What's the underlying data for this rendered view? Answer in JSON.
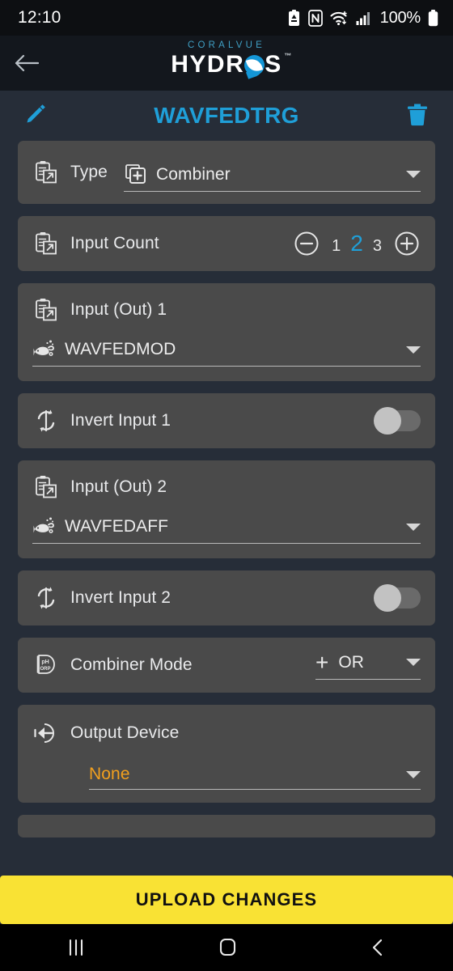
{
  "status_bar": {
    "time": "12:10",
    "battery_percent": "100%",
    "icons": [
      "battery-saver-icon",
      "nfc-icon",
      "wifi-icon",
      "cellular-signal-icon",
      "battery-icon"
    ]
  },
  "app_bar": {
    "back_icon": "arrow-left-icon",
    "brand_top": "CORALVUE",
    "brand_main_before": "HYDR",
    "brand_main_after": "S",
    "trademark": "™"
  },
  "title_bar": {
    "edit_icon": "pencil-icon",
    "title": "WAVFEDTRG",
    "delete_icon": "trash-icon",
    "title_color": "#1f9fd8"
  },
  "rows": {
    "type": {
      "icon": "clipboard-export-icon",
      "label": "Type",
      "value_icon": "add-box-icon",
      "value": "Combiner",
      "caret": "chevron-down-icon"
    },
    "input_count": {
      "icon": "clipboard-export-icon",
      "label": "Input Count",
      "minus_icon": "minus-circle-icon",
      "plus_icon": "plus-circle-icon",
      "options": [
        "1",
        "2",
        "3"
      ],
      "selected": "2",
      "selected_color": "#1f9fd8"
    },
    "input_out_1": {
      "icon": "clipboard-export-icon",
      "label": "Input (Out) 1",
      "value_icon": "fish-icon",
      "value": "WAVFEDMOD",
      "caret": "chevron-down-icon"
    },
    "invert_input_1": {
      "icon": "refresh-cycle-icon",
      "label": "Invert Input 1",
      "toggle_state": "off"
    },
    "input_out_2": {
      "icon": "clipboard-export-icon",
      "label": "Input (Out) 2",
      "value_icon": "fish-icon",
      "value": "WAVFEDAFF",
      "caret": "chevron-down-icon"
    },
    "invert_input_2": {
      "icon": "refresh-cycle-icon",
      "label": "Invert Input 2",
      "toggle_state": "off"
    },
    "combiner_mode": {
      "icon": "ph-orp-probe-icon",
      "label": "Combiner Mode",
      "prefix": "+",
      "value": "OR",
      "caret": "chevron-down-icon"
    },
    "output_device": {
      "icon": "output-arrow-icon",
      "label": "Output Device",
      "value": "None",
      "value_color": "#f2a01e",
      "caret": "chevron-down-icon"
    }
  },
  "upload_button": {
    "label": "UPLOAD CHANGES",
    "background": "#f9e234",
    "text_color": "#111111"
  },
  "nav_bar": {
    "recents_icon": "recents-icon",
    "home_icon": "home-icon",
    "back_icon": "back-chevron-icon"
  }
}
